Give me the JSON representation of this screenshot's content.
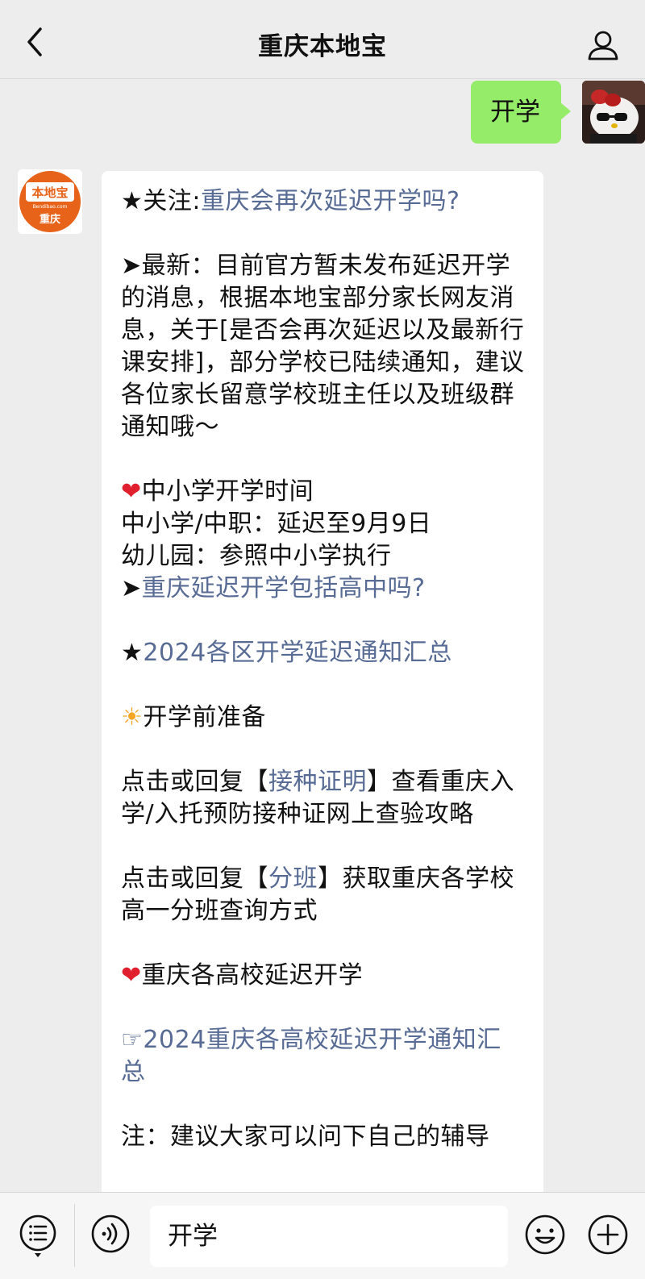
{
  "header": {
    "title": "重庆本地宝",
    "back_icon": "chevron-left-icon",
    "profile_icon": "person-icon"
  },
  "sent_message": {
    "text": "开学"
  },
  "bot": {
    "avatar_text_top": "本地宝",
    "avatar_text_mid": "Bendibao.com",
    "avatar_text_bottom": "重庆",
    "brand_color": "#e8631a"
  },
  "reply": {
    "l1_prefix": "★关注:",
    "l1_link": "重庆会再次延迟开学吗?",
    "latest_text": "➤最新：目前官方暂未发布延迟开学的消息，根据本地宝部分家长网友消息，关于[是否会再次延迟以及最新行课安排]，部分学校已陆续通知，建议各位家长留意学校班主任以及班级群通知哦～",
    "heart1_emoji": "❤",
    "heart1_title": "中小学开学时间",
    "primary": "中小学/中职：延迟至9月9日",
    "kindergarten": "幼儿园：参照中小学执行",
    "arrow_prefix": "➤",
    "highschool_link": "重庆延迟开学包括高中吗?",
    "star_prefix": "★",
    "districts_link": "2024各区开学延迟通知汇总",
    "sun_emoji": "☀",
    "prep_title": "开学前准备",
    "vacc_pre": "点击或回复【",
    "vacc_link": "接种证明",
    "vacc_post": "】查看重庆入学/入托预防接种证网上查验攻略",
    "class_pre": "点击或回复【",
    "class_link": "分班",
    "class_post": "】获取重庆各学校高一分班查询方式",
    "heart2_emoji": "❤",
    "heart2_title": "重庆各高校延迟开学",
    "hand_prefix": "☞",
    "uni_link": "2024重庆各高校延迟开学通知汇总",
    "note": "注：建议大家可以问下自己的辅导"
  },
  "input_bar": {
    "text": "开学",
    "menu_icon": "list-menu-icon",
    "voice_icon": "voice-icon",
    "emoji_icon": "smiley-icon",
    "plus_icon": "plus-icon"
  },
  "colors": {
    "sent_bubble": "#95ec69",
    "link": "#576b95",
    "background": "#ededed"
  }
}
